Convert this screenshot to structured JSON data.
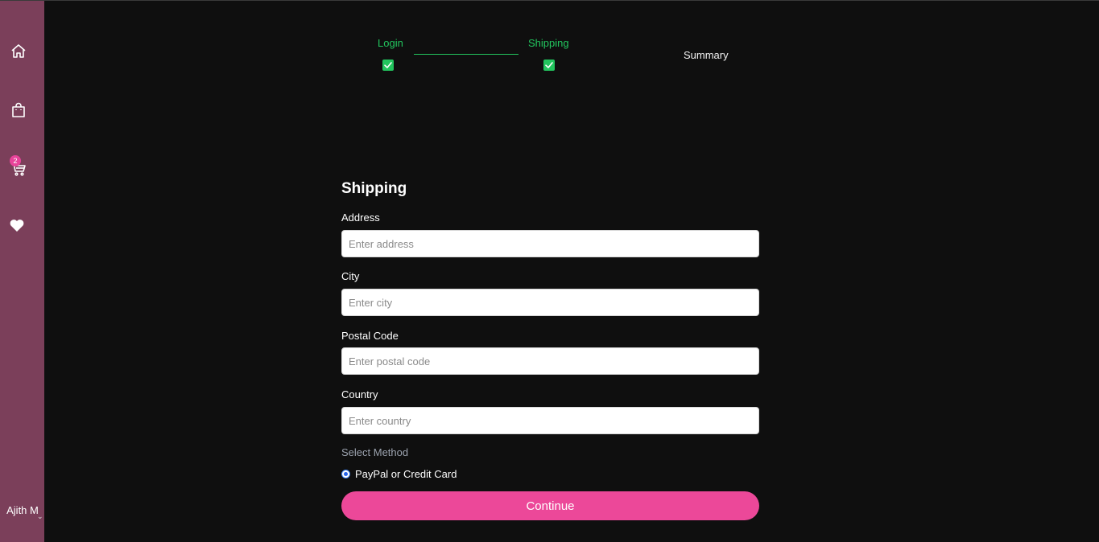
{
  "sidebar": {
    "icons": [
      "home-icon",
      "shopping-bag-icon",
      "cart-icon",
      "heart-icon"
    ],
    "cart_count": "2",
    "user_name": "Ajith M",
    "background_color": "#7b3f5a",
    "badge_color": "#e8439a"
  },
  "stepper": {
    "steps": [
      {
        "label": "Login",
        "status": "done"
      },
      {
        "label": "Shipping",
        "status": "done"
      },
      {
        "label": "Summary",
        "status": "pending"
      }
    ],
    "done_color": "#22c55e"
  },
  "form": {
    "title": "Shipping",
    "fields": [
      {
        "label": "Address",
        "placeholder": "Enter address",
        "value": ""
      },
      {
        "label": "City",
        "placeholder": "Enter city",
        "value": ""
      },
      {
        "label": "Postal Code",
        "placeholder": "Enter postal code",
        "value": ""
      },
      {
        "label": "Country",
        "placeholder": "Enter country",
        "value": ""
      }
    ],
    "method_label": "Select Method",
    "payment_option": "PayPal or Credit Card",
    "payment_selected": true,
    "submit_label": "Continue",
    "button_color": "#ec4899"
  }
}
